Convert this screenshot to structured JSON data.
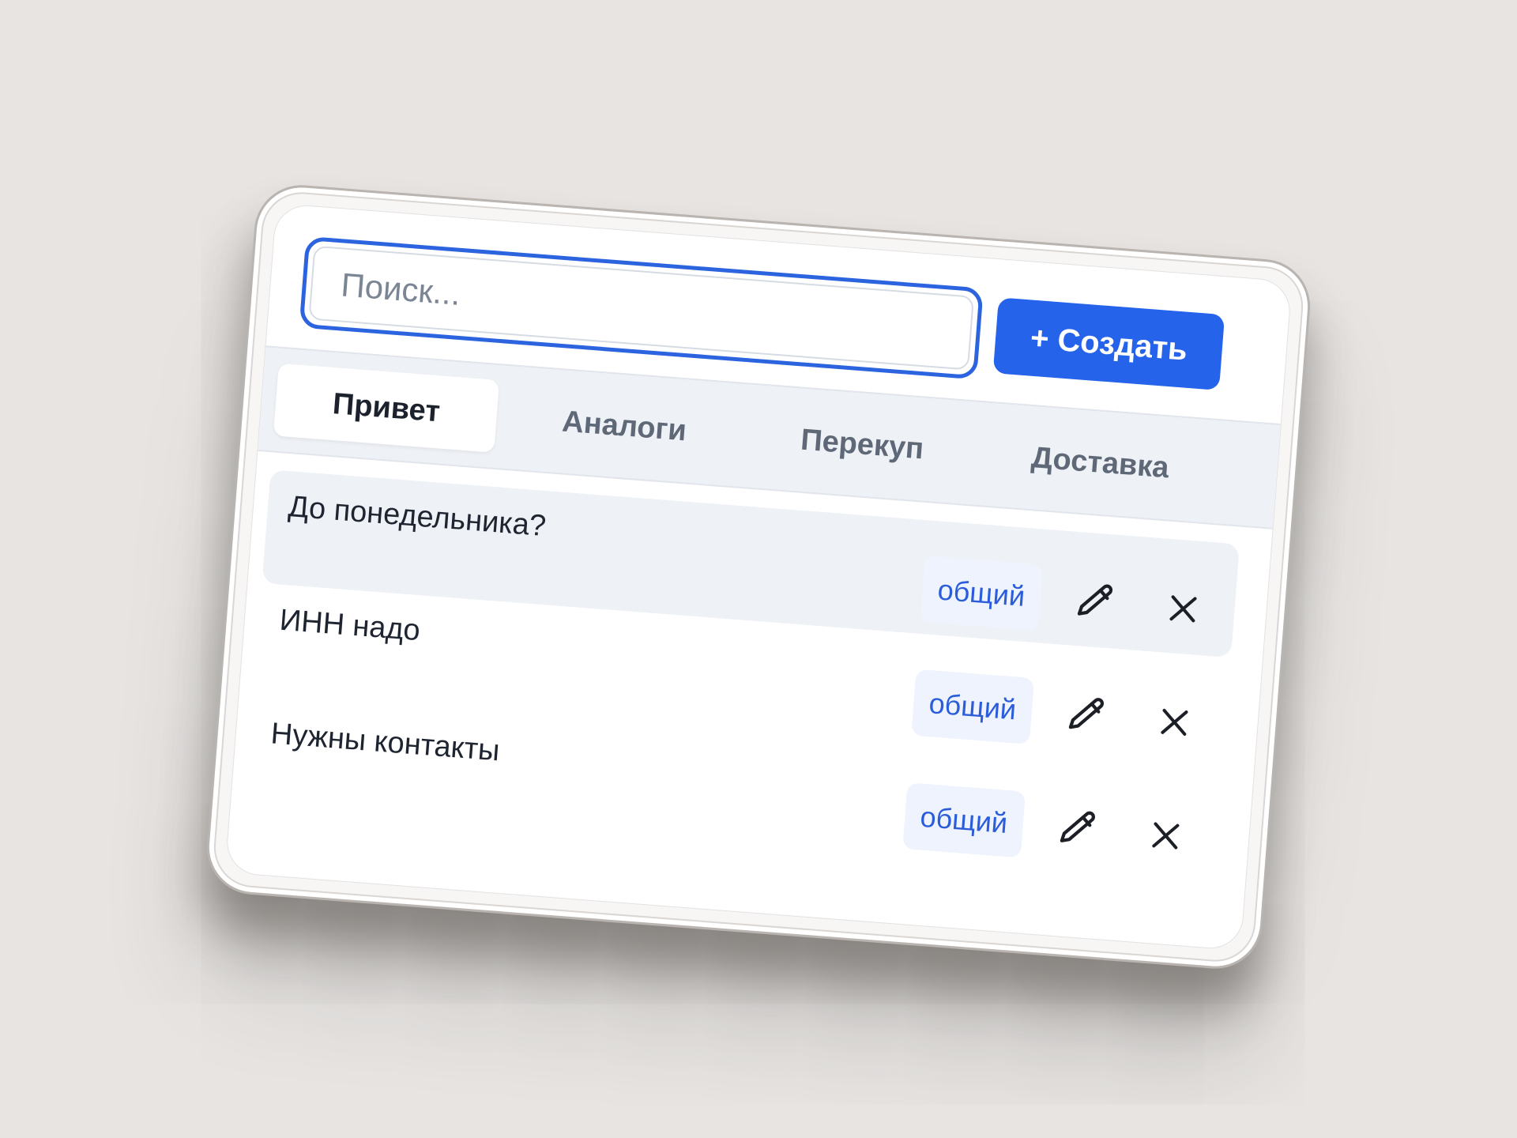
{
  "search": {
    "placeholder": "Поиск...",
    "value": ""
  },
  "toolbar": {
    "create_label": "+ Создать"
  },
  "tabs": [
    {
      "label": "Привет",
      "active": true
    },
    {
      "label": "Аналоги",
      "active": false
    },
    {
      "label": "Перекуп",
      "active": false
    },
    {
      "label": "Доставка",
      "active": false
    }
  ],
  "items": [
    {
      "text": "До понедельника?",
      "tag": "общий",
      "edit_icon": "pencil-icon",
      "delete_icon": "close-icon"
    },
    {
      "text": "ИНН надо",
      "tag": "общий",
      "edit_icon": "pencil-icon",
      "delete_icon": "close-icon"
    },
    {
      "text": "Нужны контакты",
      "tag": "общий",
      "edit_icon": "pencil-icon",
      "delete_icon": "close-icon"
    }
  ],
  "colors": {
    "accent": "#2563eb",
    "focus_ring": "#2c64e0",
    "tab_bar": "#eef1f6",
    "badge_bg": "#eef3fd",
    "badge_text": "#2b5ddb",
    "backdrop": "#e7e4e2"
  }
}
